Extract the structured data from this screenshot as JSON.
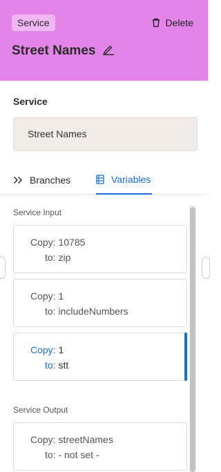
{
  "header": {
    "badge": "Service",
    "delete_label": "Delete",
    "title": "Street Names",
    "bg_color": "#e284e8"
  },
  "service_section": {
    "label": "Service",
    "value": "Street Names"
  },
  "tabs": [
    {
      "label": "Branches",
      "icon": "chevrons-right-icon",
      "active": false
    },
    {
      "label": "Variables",
      "icon": "list-icon",
      "active": true
    }
  ],
  "input_group": {
    "label": "Service Input",
    "items": [
      {
        "copy_key": "Copy:",
        "copy_value": "10785",
        "to_key": "to:",
        "to_value": "zip",
        "active": false
      },
      {
        "copy_key": "Copy:",
        "copy_value": "1",
        "to_key": "to:",
        "to_value": "includeNumbers",
        "active": false
      },
      {
        "copy_key": "Copy:",
        "copy_value": "1",
        "to_key": "to:",
        "to_value": "stt",
        "active": true
      }
    ]
  },
  "output_group": {
    "label": "Service Output",
    "items": [
      {
        "copy_key": "Copy:",
        "copy_value": "streetNames",
        "to_key": "to:",
        "to_value": "- not set -",
        "active": false
      }
    ]
  },
  "accent_color": "#1a6fd6"
}
